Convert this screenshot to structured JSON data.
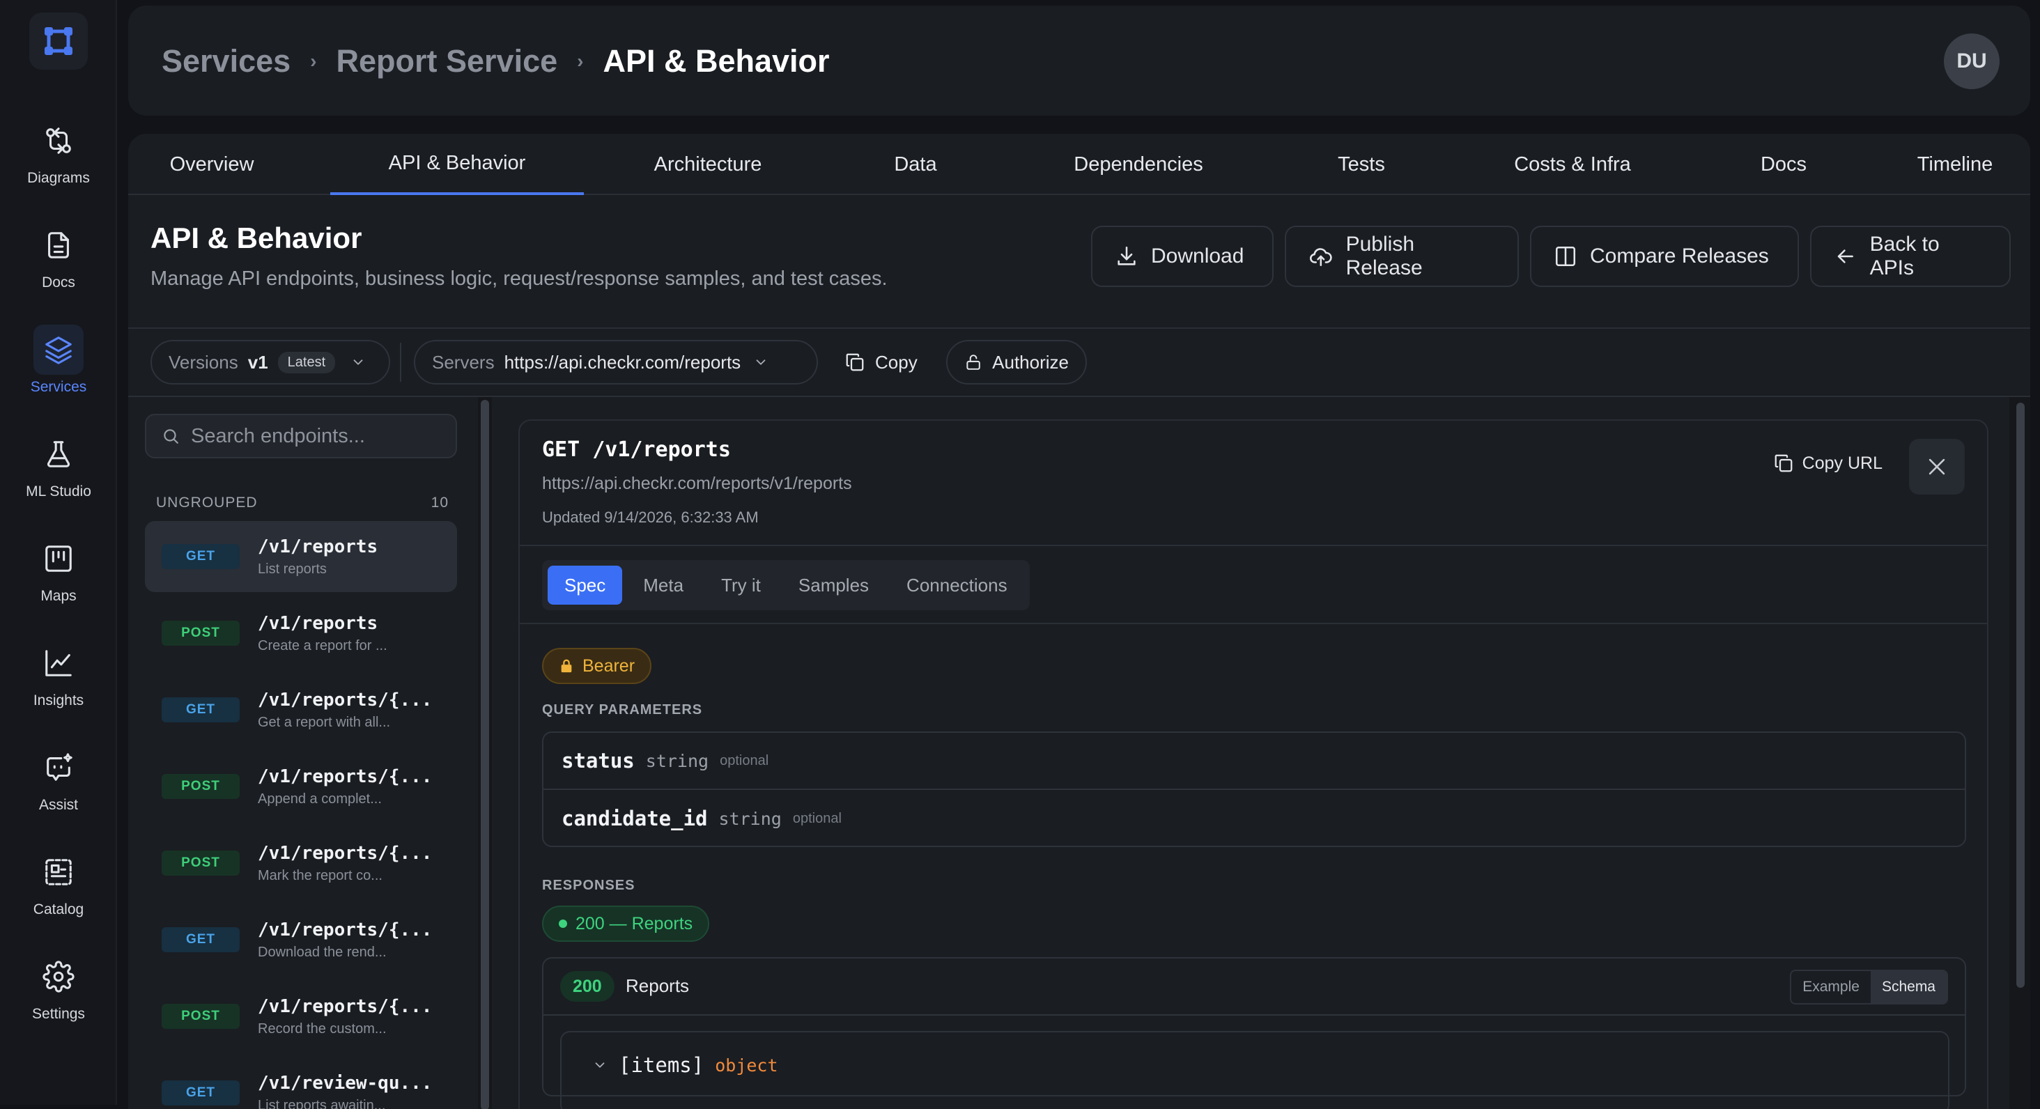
{
  "sidebar": {
    "items": [
      {
        "label": "Diagrams",
        "icon": "git-compare-icon"
      },
      {
        "label": "Docs",
        "icon": "document-icon"
      },
      {
        "label": "Services",
        "icon": "layers-icon",
        "active": true
      },
      {
        "label": "ML Studio",
        "icon": "flask-icon"
      },
      {
        "label": "Maps",
        "icon": "map-board-icon"
      },
      {
        "label": "Insights",
        "icon": "line-chart-icon"
      },
      {
        "label": "Assist",
        "icon": "bot-sparkle-icon"
      },
      {
        "label": "Catalog",
        "icon": "catalog-icon"
      },
      {
        "label": "Settings",
        "icon": "gear-icon"
      }
    ]
  },
  "header": {
    "breadcrumb": [
      "Services",
      "Report Service",
      "API & Behavior"
    ],
    "avatar": "DU"
  },
  "tabs": [
    "Overview",
    "API & Behavior",
    "Architecture",
    "Data",
    "Dependencies",
    "Tests",
    "Costs & Infra",
    "Docs",
    "Timeline"
  ],
  "active_tab": "API & Behavior",
  "page": {
    "title": "API & Behavior",
    "description": "Manage API endpoints, business logic, request/response samples, and test cases."
  },
  "actions": {
    "download": "Download",
    "publish": "Publish Release",
    "compare": "Compare Releases",
    "back": "Back to APIs"
  },
  "toolbar": {
    "versions_label": "Versions",
    "version": "v1",
    "latest": "Latest",
    "servers_label": "Servers",
    "server_url": "https://api.checkr.com/reports",
    "copy": "Copy",
    "authorize": "Authorize"
  },
  "endpoints": {
    "search_placeholder": "Search endpoints...",
    "group": "UNGROUPED",
    "count": "10",
    "items": [
      {
        "method": "GET",
        "path": "/v1/reports",
        "desc": "List reports"
      },
      {
        "method": "POST",
        "path": "/v1/reports",
        "desc": "Create a report for ..."
      },
      {
        "method": "GET",
        "path": "/v1/reports/{...",
        "desc": "Get a report with all..."
      },
      {
        "method": "POST",
        "path": "/v1/reports/{...",
        "desc": "Append a complet..."
      },
      {
        "method": "POST",
        "path": "/v1/reports/{...",
        "desc": "Mark the report co..."
      },
      {
        "method": "GET",
        "path": "/v1/reports/{...",
        "desc": "Download the rend..."
      },
      {
        "method": "POST",
        "path": "/v1/reports/{...",
        "desc": "Record the custom..."
      },
      {
        "method": "GET",
        "path": "/v1/review-qu...",
        "desc": "List reports awaitin..."
      }
    ]
  },
  "detail": {
    "method_path": "GET /v1/reports",
    "url": "https://api.checkr.com/reports/v1/reports",
    "updated": "Updated 9/14/2026, 6:32:33 AM",
    "copy_url": "Copy URL",
    "subtabs": [
      "Spec",
      "Meta",
      "Try it",
      "Samples",
      "Connections"
    ],
    "active_subtab": "Spec",
    "auth": "Bearer",
    "query_label": "QUERY PARAMETERS",
    "params": [
      {
        "name": "status",
        "type": "string",
        "req": "optional"
      },
      {
        "name": "candidate_id",
        "type": "string",
        "req": "optional"
      }
    ],
    "responses_label": "RESPONSES",
    "response_pill": "200 — Reports",
    "response_code": "200",
    "response_name": "Reports",
    "view_example": "Example",
    "view_schema": "Schema",
    "schema_item_name": "[items]",
    "schema_item_type": "object"
  },
  "colors": {
    "accent": "#3a6ff5",
    "get": "#4aa3e8",
    "post": "#3ecf7a",
    "warning": "#f0b43c"
  }
}
